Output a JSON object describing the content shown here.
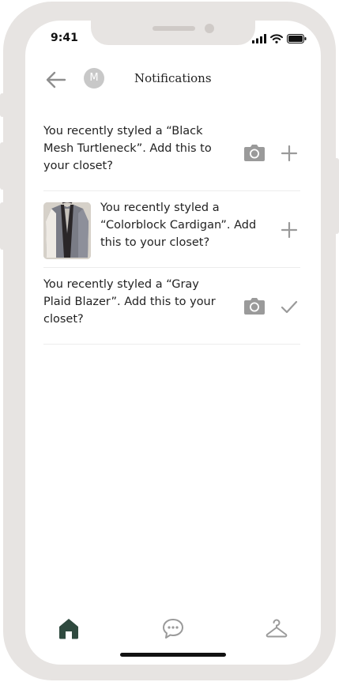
{
  "status_bar": {
    "time": "9:41"
  },
  "header": {
    "title": "Notifications",
    "avatar_initial": "M"
  },
  "notifications": [
    {
      "line1": "You recently styled a “Black",
      "line2": "Mesh Turtleneck”. Add this to",
      "line3": "your closet?",
      "has_thumbnail": false,
      "actions": [
        "camera-icon",
        "plus-icon"
      ]
    },
    {
      "line1": "You recently styled a",
      "line2": "“Colorblock Cardigan”. Add",
      "line3": "this to your closet?",
      "has_thumbnail": true,
      "actions": [
        "plus-icon"
      ]
    },
    {
      "line1": "You recently styled a “Gray",
      "line2": "Plaid Blazer”. Add this to your",
      "line3": "closet?",
      "has_thumbnail": false,
      "actions": [
        "camera-icon",
        "check-icon"
      ]
    }
  ],
  "bottom_nav": {
    "items": [
      "home-icon",
      "chat-icon",
      "hanger-icon"
    ],
    "active": "home-icon"
  },
  "colors": {
    "frame": "#e7e4e2",
    "icon_gray": "#9a9a9a",
    "nav_active": "#2f4a3f"
  }
}
